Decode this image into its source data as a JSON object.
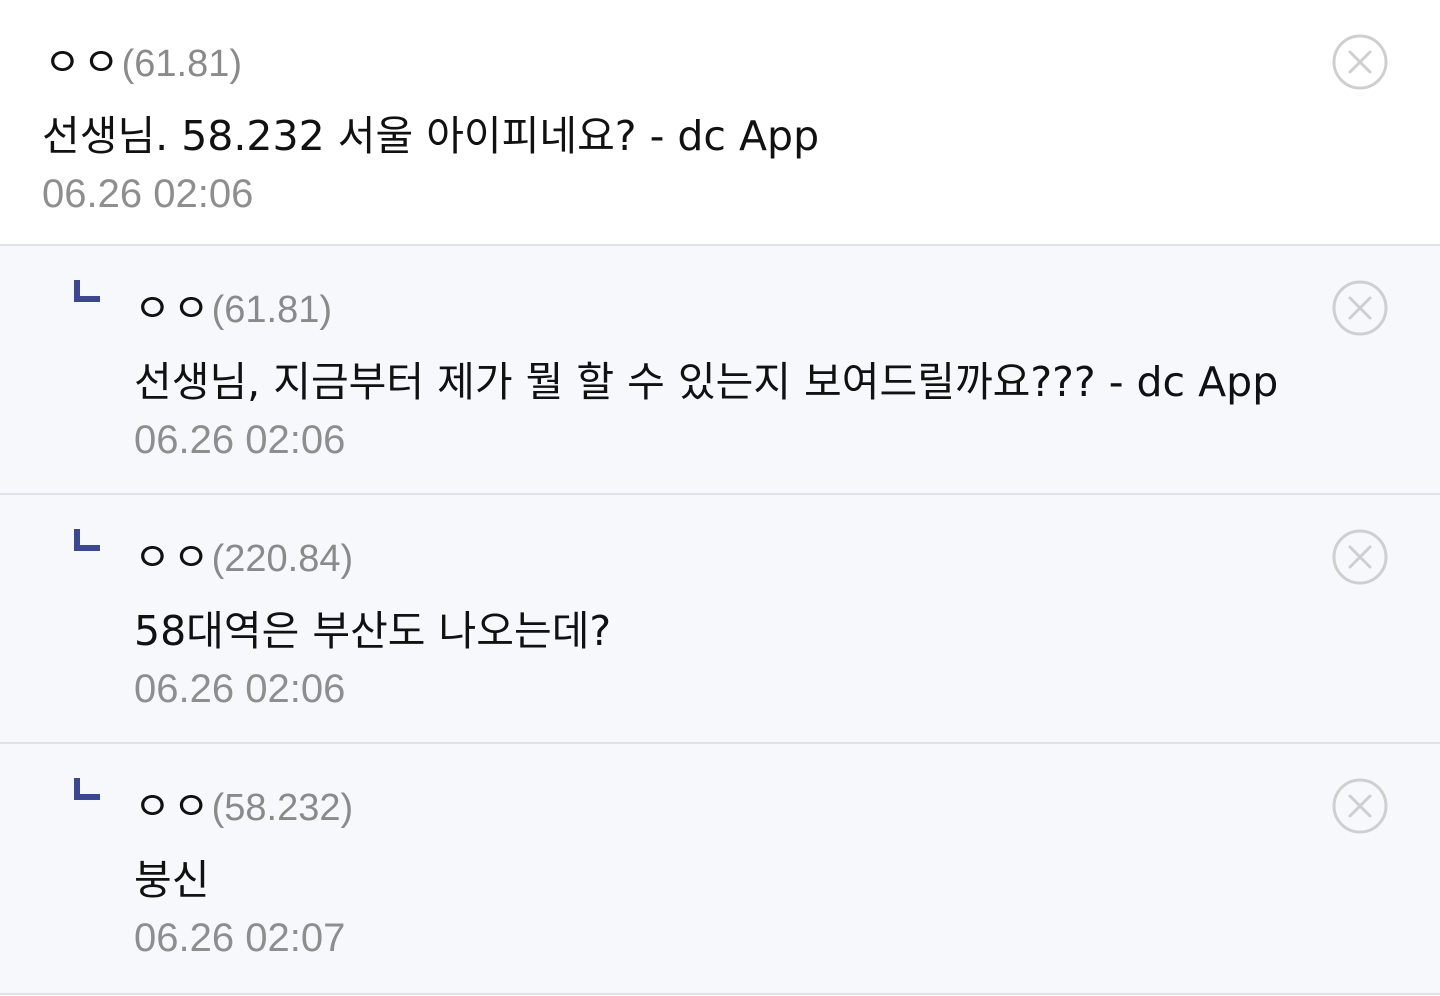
{
  "comments": [
    {
      "nick": "ㅇㅇ",
      "ip": "(61.81)",
      "text": "선생님. 58.232 서울 아이피네요? - dc App",
      "time": "06.26 02:06",
      "is_reply": false
    },
    {
      "nick": "ㅇㅇ",
      "ip": "(61.81)",
      "text": "선생님, 지금부터 제가 뭘 할 수 있는지 보여드릴까요??? - dc App",
      "time": "06.26 02:06",
      "is_reply": true
    },
    {
      "nick": "ㅇㅇ",
      "ip": "(220.84)",
      "text": "58대역은 부산도 나오는데?",
      "time": "06.26 02:06",
      "is_reply": true
    },
    {
      "nick": "ㅇㅇ",
      "ip": "(58.232)",
      "text": "붕신",
      "time": "06.26 02:07",
      "is_reply": true
    }
  ],
  "icons": {
    "delete": "close-circle-icon",
    "reply": "reply-arrow-icon"
  },
  "colors": {
    "reply_marker": "#3b4890",
    "reply_background": "#f7f8fb",
    "divider": "#dfe2ea",
    "meta_text": "#8e8e8e",
    "body_text": "#111111"
  }
}
